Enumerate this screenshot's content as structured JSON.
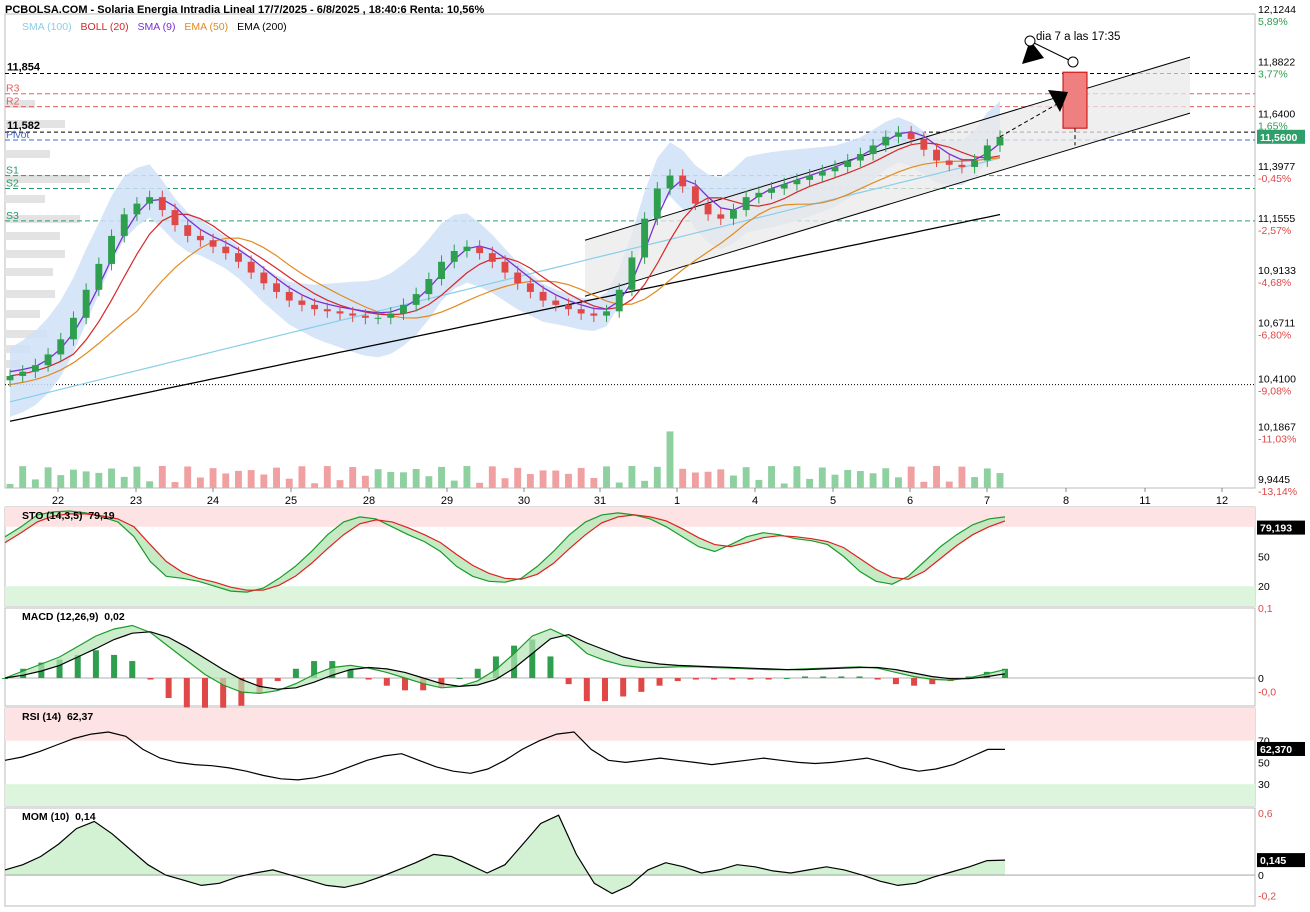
{
  "header": {
    "title": "PCBOLSA.COM - Solaria Energia Intradia Lineal 17/7/2025 - 6/8/2025 , 18:40:6 Renta: 10,56%"
  },
  "legend": [
    {
      "label": "SMA (100)",
      "color": "#87ceeb"
    },
    {
      "label": "BOLL (20)",
      "color": "#d62728"
    },
    {
      "label": "SMA (9)",
      "color": "#7b2fd6"
    },
    {
      "label": "EMA (50)",
      "color": "#e38a1f"
    },
    {
      "label": "EMA (200)",
      "color": "#000000"
    }
  ],
  "colors": {
    "up": "#2e9e4f",
    "down": "#e04848",
    "boll_fill": "#cfe0f6",
    "sma100": "#87ceeb",
    "boll_mid": "#d62728",
    "sma9": "#7b2fd6",
    "ema50": "#e38a1f",
    "ema200": "#000000",
    "last_price_bg": "#2e9e6a",
    "pos": "#2e9e4f",
    "neg": "#e04848"
  },
  "annotation": "dia 7 a las 17:35",
  "chart_data": [
    {
      "type": "line",
      "name": "main",
      "x_ticks": [
        "22",
        "23",
        "24",
        "25",
        "28",
        "29",
        "30",
        "31",
        "1",
        "4",
        "5",
        "6",
        "7",
        "8",
        "11",
        "12"
      ],
      "y_ticks": [
        "12,1244",
        "11,8822",
        "11,6400",
        "11,3977",
        "11,1555",
        "10,9133",
        "10,6711",
        "10,4100",
        "10,1867",
        "9,9445"
      ],
      "pct_ticks": [
        "5,89%",
        "3,77%",
        "1,65%",
        "-0,45%",
        "-2,57%",
        "-4,68%",
        "-6,80%",
        "-9,08%",
        "-11,03%",
        "-13,14%"
      ],
      "ylim": [
        9.93,
        12.13
      ],
      "last_price": "11,5600",
      "level_labels": [
        {
          "label": "11,854",
          "value": 11.854
        },
        {
          "label": "11,582",
          "value": 11.582
        }
      ],
      "pivots": [
        {
          "label": "R3",
          "value": 11.76
        },
        {
          "label": "R2",
          "value": 11.7
        },
        {
          "label": "Pivot",
          "value": 11.545
        },
        {
          "label": "S1",
          "value": 11.38
        },
        {
          "label": "S2",
          "value": 11.32
        },
        {
          "label": "S3",
          "value": 11.17
        }
      ],
      "close": [
        10.45,
        10.47,
        10.5,
        10.55,
        10.62,
        10.72,
        10.85,
        10.97,
        11.1,
        11.2,
        11.25,
        11.28,
        11.22,
        11.15,
        11.1,
        11.08,
        11.05,
        11.02,
        10.98,
        10.93,
        10.88,
        10.84,
        10.8,
        10.78,
        10.76,
        10.75,
        10.74,
        10.73,
        10.72,
        10.72,
        10.74,
        10.78,
        10.83,
        10.9,
        10.98,
        11.03,
        11.05,
        11.02,
        10.98,
        10.93,
        10.88,
        10.84,
        10.8,
        10.78,
        10.76,
        10.74,
        10.73,
        10.75,
        10.85,
        11.0,
        11.18,
        11.32,
        11.38,
        11.33,
        11.25,
        11.2,
        11.18,
        11.22,
        11.28,
        11.3,
        11.32,
        11.34,
        11.36,
        11.38,
        11.4,
        11.42,
        11.45,
        11.48,
        11.52,
        11.56,
        11.58,
        11.55,
        11.5,
        11.45,
        11.43,
        11.42,
        11.45,
        11.52,
        11.56
      ]
    },
    {
      "type": "line",
      "name": "STO (14,3,5)",
      "value": "79,19",
      "last_value": "79,193",
      "y_ticks": [
        "50",
        "20"
      ],
      "ylim": [
        0,
        100
      ],
      "k": [
        70,
        80,
        92,
        95,
        96,
        94,
        90,
        85,
        70,
        45,
        30,
        28,
        25,
        20,
        15,
        14,
        18,
        28,
        40,
        55,
        72,
        85,
        90,
        88,
        80,
        72,
        65,
        55,
        40,
        30,
        25,
        24,
        28,
        40,
        55,
        72,
        85,
        92,
        94,
        92,
        88,
        80,
        70,
        60,
        55,
        62,
        70,
        74,
        72,
        68,
        66,
        62,
        50,
        35,
        25,
        22,
        30,
        45,
        60,
        72,
        82,
        88,
        90
      ],
      "d": [
        64,
        74,
        85,
        91,
        93,
        93,
        91,
        88,
        80,
        62,
        45,
        34,
        28,
        24,
        19,
        16,
        16,
        21,
        30,
        43,
        58,
        72,
        83,
        87,
        85,
        79,
        72,
        64,
        52,
        41,
        33,
        28,
        27,
        32,
        43,
        58,
        72,
        84,
        90,
        92,
        90,
        86,
        78,
        69,
        62,
        60,
        64,
        69,
        71,
        70,
        68,
        65,
        59,
        48,
        37,
        29,
        27,
        35,
        48,
        61,
        72,
        80,
        86
      ],
      "zones": {
        "upper": 80,
        "lower": 20
      }
    },
    {
      "type": "line",
      "name": "MACD (12,26,9)",
      "value": "0,02",
      "y_ticks": [
        "0,1",
        "0",
        "-0,0"
      ],
      "ylim": [
        -0.04,
        0.1
      ],
      "macd": [
        0.0,
        0.01,
        0.02,
        0.03,
        0.045,
        0.06,
        0.07,
        0.075,
        0.065,
        0.045,
        0.025,
        0.005,
        -0.01,
        -0.02,
        -0.022,
        -0.018,
        -0.008,
        0.005,
        0.015,
        0.018,
        0.014,
        0.008,
        0.0,
        -0.008,
        -0.014,
        -0.012,
        -0.004,
        0.012,
        0.035,
        0.06,
        0.07,
        0.058,
        0.035,
        0.025,
        0.018,
        0.015,
        0.015,
        0.016,
        0.016,
        0.015,
        0.014,
        0.013,
        0.012,
        0.012,
        0.013,
        0.014,
        0.015,
        0.016,
        0.014,
        0.008,
        0.002,
        -0.002,
        -0.003,
        0.0,
        0.006,
        0.012
      ],
      "signal": [
        0.0,
        0.004,
        0.01,
        0.018,
        0.03,
        0.042,
        0.055,
        0.064,
        0.066,
        0.058,
        0.044,
        0.028,
        0.012,
        -0.002,
        -0.012,
        -0.016,
        -0.014,
        -0.006,
        0.004,
        0.012,
        0.015,
        0.013,
        0.008,
        0.0,
        -0.008,
        -0.012,
        -0.01,
        -0.002,
        0.014,
        0.035,
        0.056,
        0.062,
        0.05,
        0.04,
        0.03,
        0.024,
        0.02,
        0.018,
        0.017,
        0.016,
        0.015,
        0.014,
        0.013,
        0.012,
        0.012,
        0.013,
        0.014,
        0.015,
        0.015,
        0.012,
        0.007,
        0.002,
        -0.001,
        -0.001,
        0.002,
        0.006
      ]
    },
    {
      "type": "line",
      "name": "RSI (14)",
      "value": "62,37",
      "last_value": "62,370",
      "y_ticks": [
        "70",
        "50",
        "30"
      ],
      "ylim": [
        10,
        100
      ],
      "values": [
        52,
        55,
        60,
        66,
        72,
        76,
        78,
        74,
        62,
        54,
        50,
        48,
        47,
        45,
        42,
        38,
        35,
        34,
        36,
        40,
        46,
        52,
        56,
        58,
        52,
        46,
        42,
        40,
        44,
        52,
        62,
        70,
        76,
        78,
        62,
        52,
        50,
        52,
        54,
        52,
        50,
        48,
        50,
        52,
        54,
        52,
        50,
        49,
        50,
        52,
        54,
        50,
        45,
        42,
        44,
        48,
        55,
        62,
        62
      ],
      "zones": {
        "upper": 70,
        "lower": 30
      }
    },
    {
      "type": "line",
      "name": "MOM (10)",
      "value": "0,14",
      "last_value": "0,145",
      "y_ticks": [
        "0,6",
        "0",
        "-0,2"
      ],
      "ylim": [
        -0.3,
        0.65
      ],
      "values": [
        0.05,
        0.1,
        0.18,
        0.3,
        0.45,
        0.52,
        0.4,
        0.25,
        0.1,
        0.0,
        -0.05,
        -0.1,
        -0.08,
        -0.02,
        0.02,
        0.05,
        0.0,
        -0.05,
        -0.1,
        -0.12,
        -0.08,
        -0.02,
        0.05,
        0.12,
        0.2,
        0.18,
        0.1,
        0.02,
        0.1,
        0.3,
        0.5,
        0.58,
        0.2,
        -0.08,
        -0.18,
        -0.1,
        0.05,
        0.12,
        0.08,
        0.02,
        0.05,
        0.1,
        0.08,
        0.04,
        0.02,
        0.05,
        0.08,
        0.05,
        0.0,
        -0.06,
        -0.1,
        -0.08,
        -0.02,
        0.03,
        0.08,
        0.14,
        0.145
      ]
    }
  ]
}
